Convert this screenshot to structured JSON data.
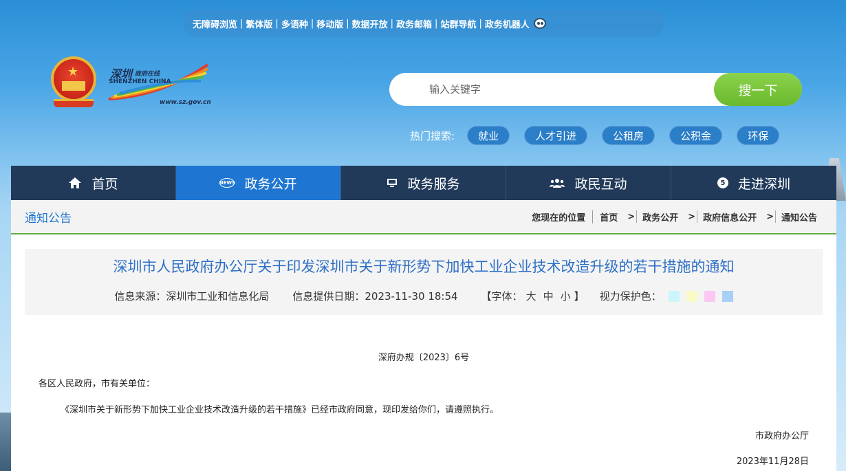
{
  "util_bar": {
    "items": [
      "无障碍浏览",
      "繁体版",
      "多语种",
      "移动版",
      "数据开放",
      "政务邮箱",
      "站群导航",
      "政务机器人"
    ]
  },
  "logo": {
    "cn": "深圳",
    "cn_small": "政府在线",
    "en": "SHENZHEN CHINA",
    "url": "www.sz.gov.cn"
  },
  "search": {
    "placeholder": "输入关键字",
    "button": "搜一下"
  },
  "hot": {
    "label": "热门搜索:",
    "tags": [
      "就业",
      "人才引进",
      "公租房",
      "公积金",
      "环保"
    ]
  },
  "nav": {
    "items": [
      {
        "label": "首页",
        "icon": "home-icon"
      },
      {
        "label": "政务公开",
        "icon": "news-icon"
      },
      {
        "label": "政务服务",
        "icon": "monitor-icon"
      },
      {
        "label": "政民互动",
        "icon": "users-icon"
      },
      {
        "label": "走进深圳",
        "icon": "info-icon"
      }
    ],
    "news_badge": "NEWS",
    "circle_badge": "5"
  },
  "breadcrumb": {
    "section_title": "通知公告",
    "location_label": "您现在的位置",
    "items": [
      "首页",
      "政务公开",
      "政府信息公开",
      "通知公告"
    ]
  },
  "article": {
    "title": "深圳市人民政府办公厅关于印发深圳市关于新形势下加快工业企业技术改造升级的若干措施的通知",
    "source": "信息来源：深圳市工业和信息化局",
    "date": "信息提供日期：2023-11-30 18:54",
    "font_label": "【字体：",
    "font_large": "大",
    "font_medium": "中",
    "font_small": "小",
    "font_close": "】",
    "eye_label": "视力保护色：",
    "swatches": [
      "#ccf5fb",
      "#fbfbc8",
      "#fbc8f4",
      "#a8cff5"
    ],
    "doc_no": "深府办规〔2023〕6号",
    "addressee": "各区人民政府，市有关单位：",
    "body": "《深圳市关于新形势下加快工业企业技术改造升级的若干措施》已经市政府同意，现印发给你们，请遵照执行。",
    "issuer": "市政府办公厅",
    "issue_date": "2023年11月28日"
  }
}
